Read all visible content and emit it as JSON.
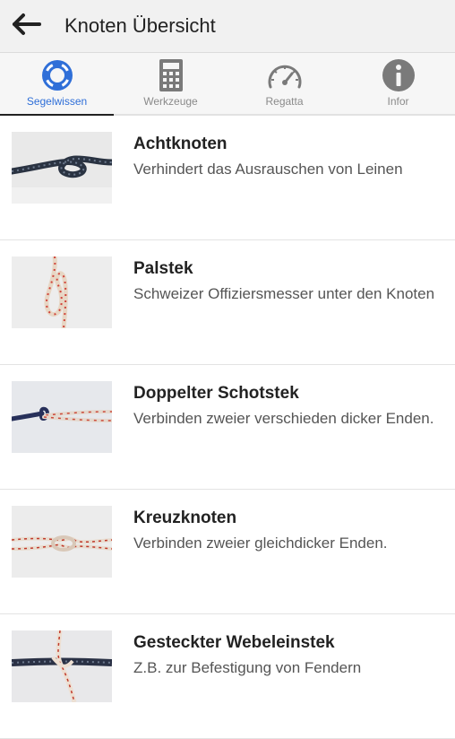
{
  "header": {
    "title": "Knoten Übersicht"
  },
  "tabs": [
    {
      "label": "Segelwissen",
      "icon": "lifebuoy-icon",
      "active": true
    },
    {
      "label": "Werkzeuge",
      "icon": "calculator-icon",
      "active": false
    },
    {
      "label": "Regatta",
      "icon": "speedometer-icon",
      "active": false
    },
    {
      "label": "Infor",
      "icon": "info-icon",
      "active": false
    }
  ],
  "knots": [
    {
      "name": "Achtknoten",
      "description": "Verhindert das Ausrauschen von Leinen"
    },
    {
      "name": "Palstek",
      "description": "Schweizer Offiziersmesser unter den Knoten"
    },
    {
      "name": "Doppelter Schotstek",
      "description": "Verbinden zweier verschieden dicker Enden."
    },
    {
      "name": "Kreuzknoten",
      "description": "Verbinden zweier gleichdicker Enden."
    },
    {
      "name": "Gesteckter Webeleinstek",
      "description": "Z.B. zur Befestigung von Fendern"
    }
  ],
  "colors": {
    "accent": "#2f6fd8",
    "appbar": "#f1f1f1",
    "tab_inactive": "#8a8a8a"
  }
}
